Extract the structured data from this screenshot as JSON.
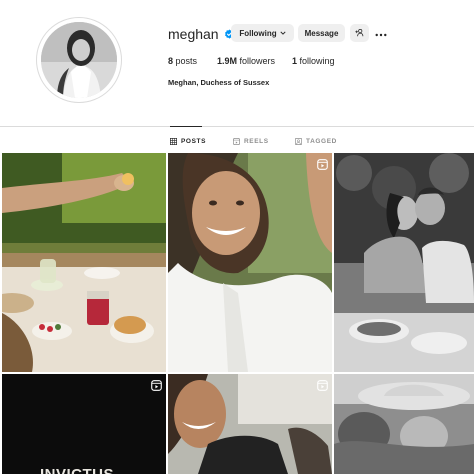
{
  "profile": {
    "username": "meghan",
    "full_name": "Meghan, Duchess of Sussex",
    "verified": true,
    "buttons": {
      "following": "Following",
      "message": "Message"
    },
    "stats": {
      "posts_count": "8",
      "posts_label": "posts",
      "followers_count": "1.9M",
      "followers_label": "followers",
      "following_count": "1",
      "following_label": "following"
    }
  },
  "tabs": [
    {
      "label": "POSTS",
      "active": true,
      "icon": "grid-icon"
    },
    {
      "label": "REELS",
      "active": false,
      "icon": "reels-icon"
    },
    {
      "label": "TAGGED",
      "active": false,
      "icon": "tagged-icon"
    }
  ],
  "posts": [
    {
      "id": 1,
      "type": "photo",
      "description_icon": "image"
    },
    {
      "id": 2,
      "type": "reel",
      "description_icon": "reel-icon"
    },
    {
      "id": 3,
      "type": "photo",
      "description_icon": "image"
    },
    {
      "id": 4,
      "type": "reel",
      "description_icon": "reel-icon",
      "overlay_text": "INVICTUS"
    },
    {
      "id": 5,
      "type": "reel",
      "description_icon": "reel-icon"
    },
    {
      "id": 6,
      "type": "photo",
      "description_icon": "image"
    }
  ],
  "colors": {
    "verified_blue": "#0095f6",
    "button_bg": "#efefef",
    "text_primary": "#262626",
    "text_secondary": "#8e8e8e",
    "divider": "#dbdbdb"
  }
}
